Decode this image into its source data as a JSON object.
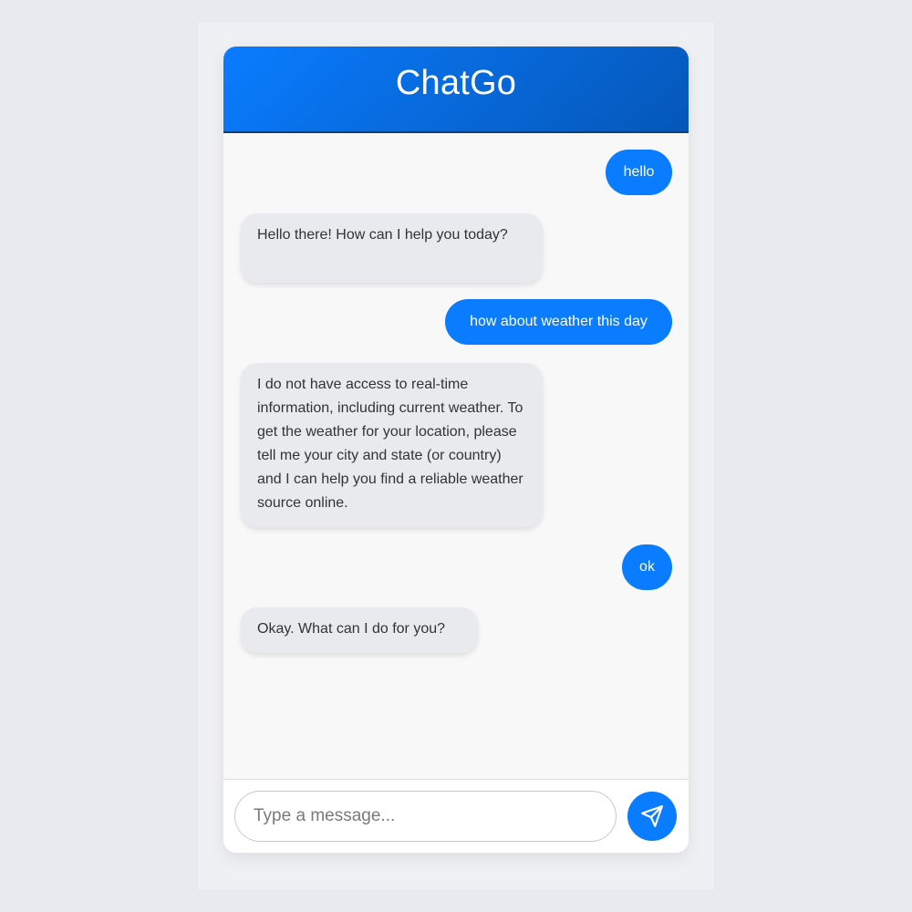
{
  "header": {
    "title": "ChatGo"
  },
  "messages": [
    {
      "role": "user",
      "text": "hello"
    },
    {
      "role": "bot",
      "text": "Hello there! How can I help you today?"
    },
    {
      "role": "user",
      "text": "how about weather this day"
    },
    {
      "role": "bot",
      "text": "I do not have access to real-time information, including current weather. To get the weather for your location, please tell me your city and state (or country) and I can help you find a reliable weather source online."
    },
    {
      "role": "user",
      "text": "ok"
    },
    {
      "role": "bot",
      "text": "Okay. What can I do for you?"
    }
  ],
  "input": {
    "placeholder": "Type a message...",
    "value": ""
  },
  "send": {
    "icon": "send-icon"
  },
  "colors": {
    "accent": "#0a7cff",
    "header_start": "#0a7cff",
    "header_end": "#0557b8",
    "bot_bubble": "#e8eaed",
    "page_bg": "#e7eaee"
  }
}
